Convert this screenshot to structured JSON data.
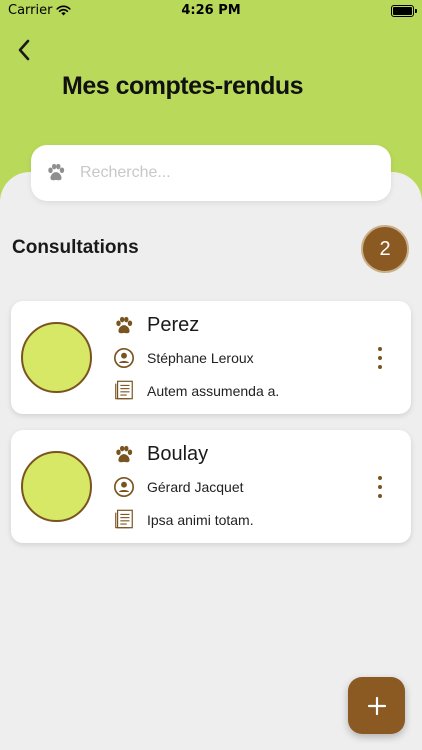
{
  "status_bar": {
    "carrier": "Carrier",
    "time": "4:26 PM",
    "battery_level": 1.0
  },
  "header": {
    "back_icon": "chevron-left-icon",
    "title": "Mes comptes-rendus"
  },
  "search": {
    "icon": "paw-icon",
    "placeholder": "Recherche...",
    "value": ""
  },
  "section": {
    "title": "Consultations",
    "count": "2"
  },
  "cards": [
    {
      "name": "Perez",
      "vet": "Stéphane Leroux",
      "note": "Autem assumenda a."
    },
    {
      "name": "Boulay",
      "vet": "Gérard Jacquet",
      "note": "Ipsa animi totam."
    }
  ],
  "fab": {
    "icon": "plus-icon"
  },
  "colors": {
    "header_green": "#b9d95a",
    "brown": "#8a5a22",
    "avatar_fill": "#d6e866",
    "background": "#eeeeee"
  }
}
